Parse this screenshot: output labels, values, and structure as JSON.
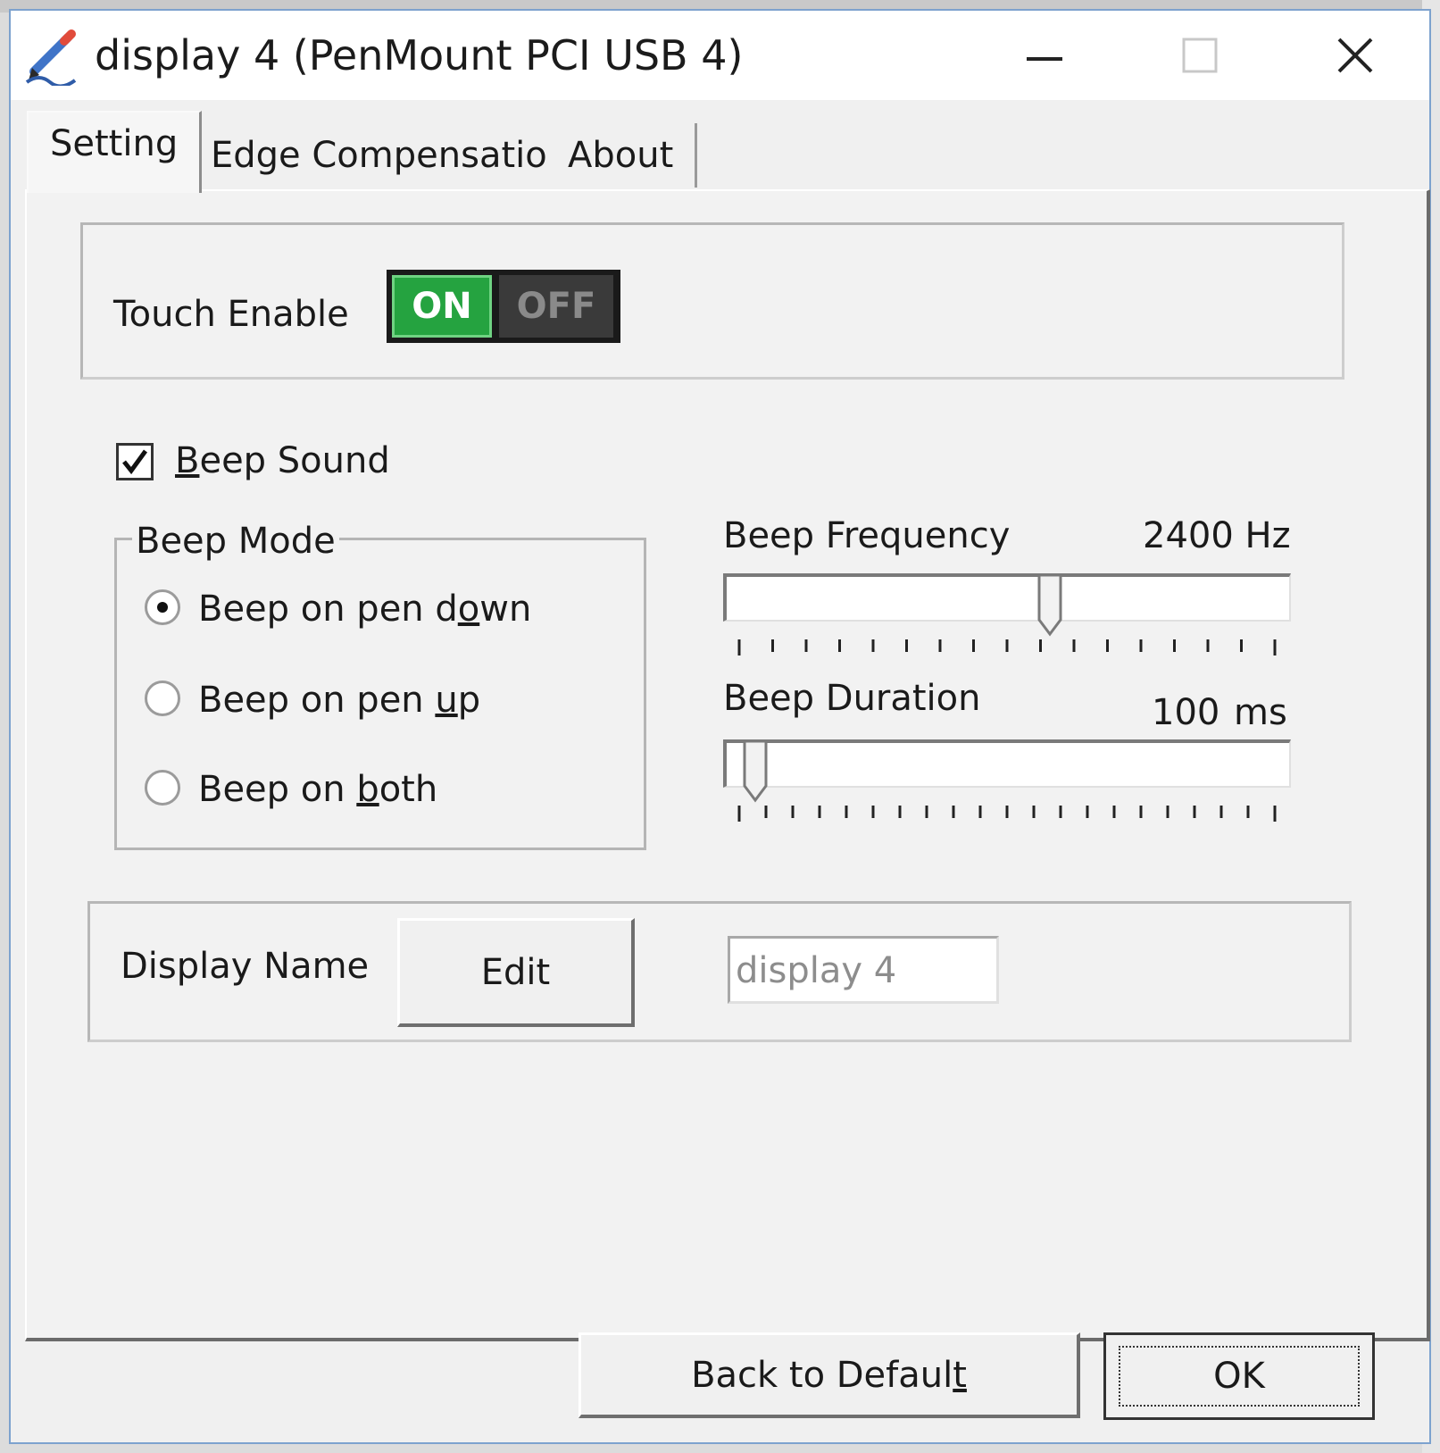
{
  "window": {
    "title": "display 4 (PenMount PCI USB 4)",
    "icon": "pen-icon"
  },
  "tabs": [
    {
      "label": "Setting",
      "active": true
    },
    {
      "label": "Edge Compensation",
      "active": false
    },
    {
      "label": "About",
      "active": false
    }
  ],
  "touch": {
    "label": "Touch Enable",
    "on_label": "ON",
    "off_label": "OFF",
    "state": "on",
    "on_color": "#25a340"
  },
  "beep_sound": {
    "label_first": "B",
    "label_rest": "eep Sound",
    "checked": true
  },
  "beep_mode": {
    "legend": "Beep Mode",
    "options": [
      {
        "prefix": "Beep on pen d",
        "accel": "o",
        "suffix": "wn",
        "selected": true
      },
      {
        "prefix": "Beep on pen ",
        "accel": "u",
        "suffix": "p",
        "selected": false
      },
      {
        "prefix": "Beep on ",
        "accel": "b",
        "suffix": "oth",
        "selected": false
      }
    ]
  },
  "frequency": {
    "label": "Beep Frequency",
    "value_text": "2400 Hz",
    "level": 0.58,
    "tick_count": 17
  },
  "duration": {
    "label": "Beep Duration",
    "value_text": "100",
    "unit": "ms",
    "level": 0.03,
    "tick_count": 21
  },
  "display_name": {
    "label": "Display Name",
    "edit_label": "Edit",
    "value": "display 4"
  },
  "footer": {
    "default_prefix": "Back to Defaul",
    "default_accel": "t",
    "ok_label": "OK"
  }
}
